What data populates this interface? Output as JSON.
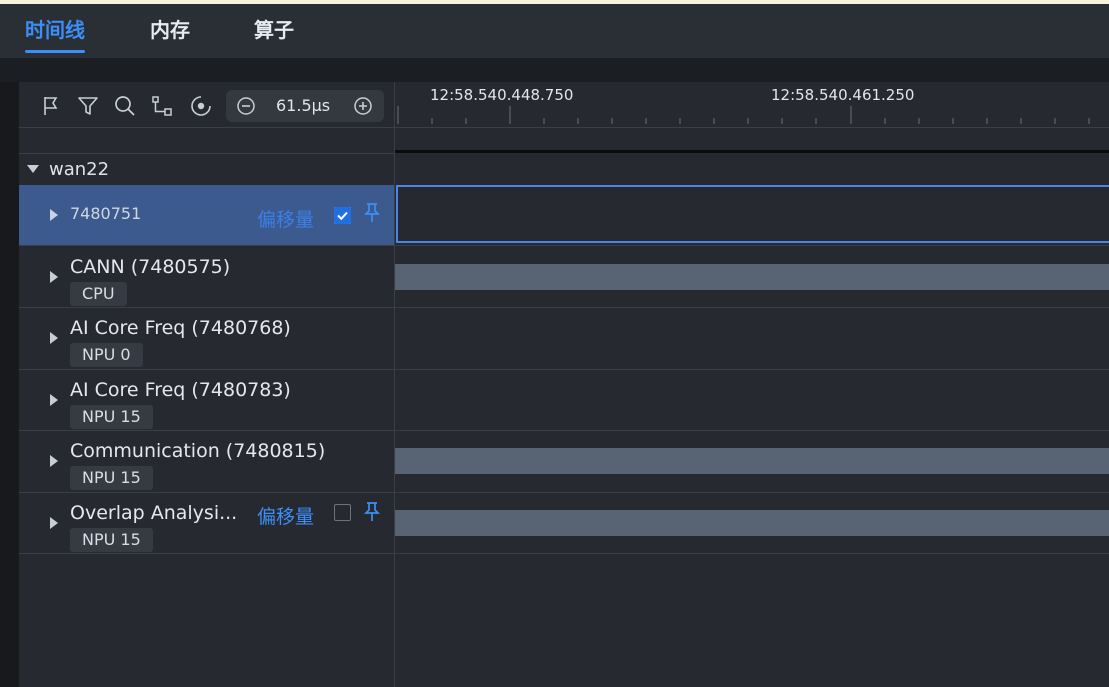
{
  "tabs": [
    {
      "label": "时间线",
      "active": true
    },
    {
      "label": "内存",
      "active": false
    },
    {
      "label": "算子",
      "active": false
    }
  ],
  "toolbar": {
    "icons": [
      "flag-icon",
      "filter-icon",
      "search-icon",
      "link-icon",
      "locate-icon"
    ],
    "zoom_value": "61.5μs"
  },
  "ruler": {
    "labels": [
      "12:58.540.448.750",
      "12:58.540.461.250"
    ]
  },
  "group": {
    "label": "wan22",
    "expanded": true
  },
  "rows": [
    {
      "title": "7480751",
      "tag": "",
      "offset_label": "偏移量",
      "checked": true,
      "selected": true,
      "has_bar": false
    },
    {
      "title": "CANN (7480575)",
      "tag": "CPU",
      "has_bar": true
    },
    {
      "title": "AI Core Freq (7480768)",
      "tag": "NPU 0",
      "has_bar": false
    },
    {
      "title": "AI Core Freq (7480783)",
      "tag": "NPU 15",
      "has_bar": false
    },
    {
      "title": "Communication (7480815)",
      "tag": "NPU 15",
      "has_bar": true
    },
    {
      "title": "Overlap Analysi...",
      "tag": "NPU 15",
      "offset_label": "偏移量",
      "checked": false,
      "has_bar": true
    }
  ],
  "colors": {
    "accent": "#3b8ff6",
    "selected_row": "#3c5a8d",
    "bar": "#586473"
  }
}
